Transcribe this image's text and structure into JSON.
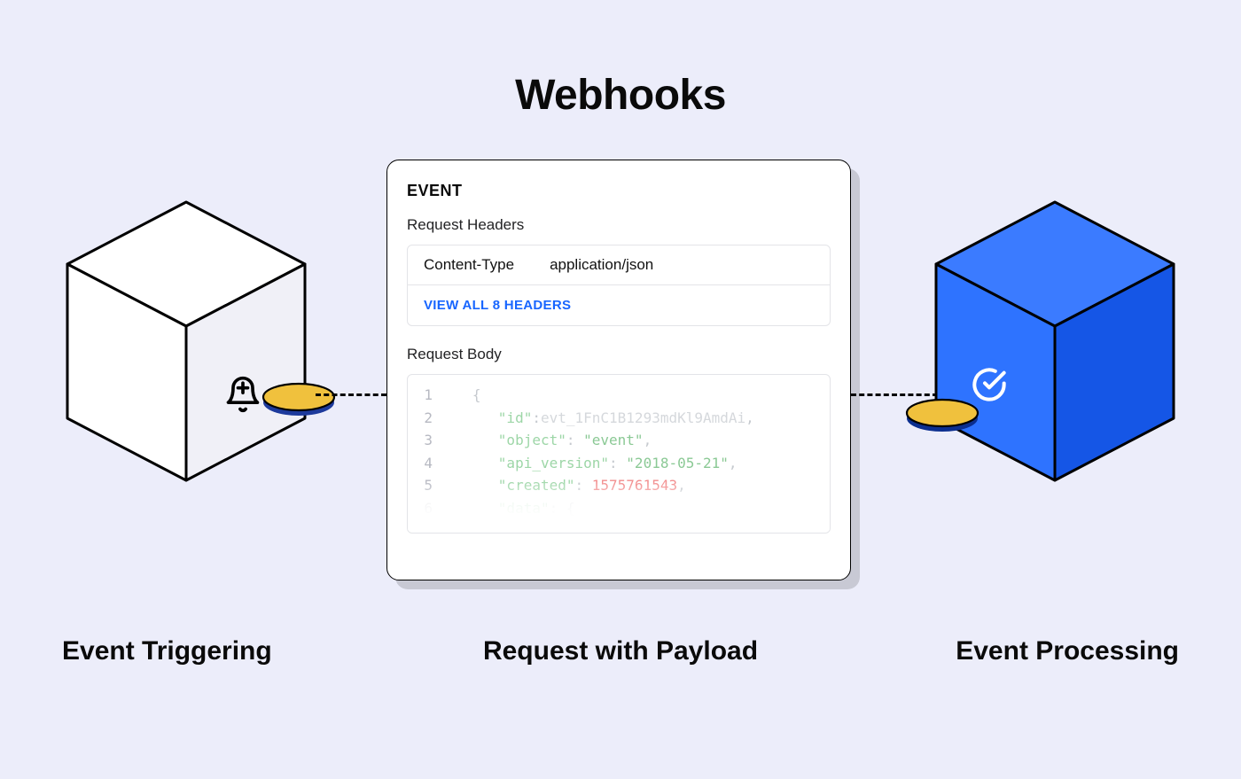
{
  "title": "Webhooks",
  "card": {
    "heading": "EVENT",
    "request_headers_label": "Request Headers",
    "header_row": {
      "key": "Content-Type",
      "value": "application/json"
    },
    "view_all": "VIEW ALL 8 HEADERS",
    "request_body_label": "Request Body"
  },
  "body_lines": [
    {
      "n": "1",
      "txt": "{"
    },
    {
      "n": "2",
      "key": "\"id\"",
      "sep": ":",
      "val": "evt_1FnC1B1293mdKl9AmdAi",
      "tail": ","
    },
    {
      "n": "3",
      "key": "\"object\"",
      "sep": ": ",
      "val": "\"event\"",
      "tail": ","
    },
    {
      "n": "4",
      "key": "\"api_version\"",
      "sep": ": ",
      "val": "\"2018-05-21\"",
      "tail": ","
    },
    {
      "n": "5",
      "key": "\"created\"",
      "sep": ": ",
      "num": "1575761543",
      "tail": ","
    },
    {
      "n": "6",
      "key": "\"data\"",
      "sep": ": ",
      "txt": "{"
    }
  ],
  "captions": {
    "left": "Event Triggering",
    "center": "Request with Payload",
    "right": "Event Processing"
  },
  "icons": {
    "left_cube_icon": "bell-plus-icon",
    "right_cube_icon": "check-circle-icon"
  },
  "colors": {
    "accent": "#1866ff",
    "coin": "#f0c13d",
    "cube_right": "#2e73ff"
  }
}
